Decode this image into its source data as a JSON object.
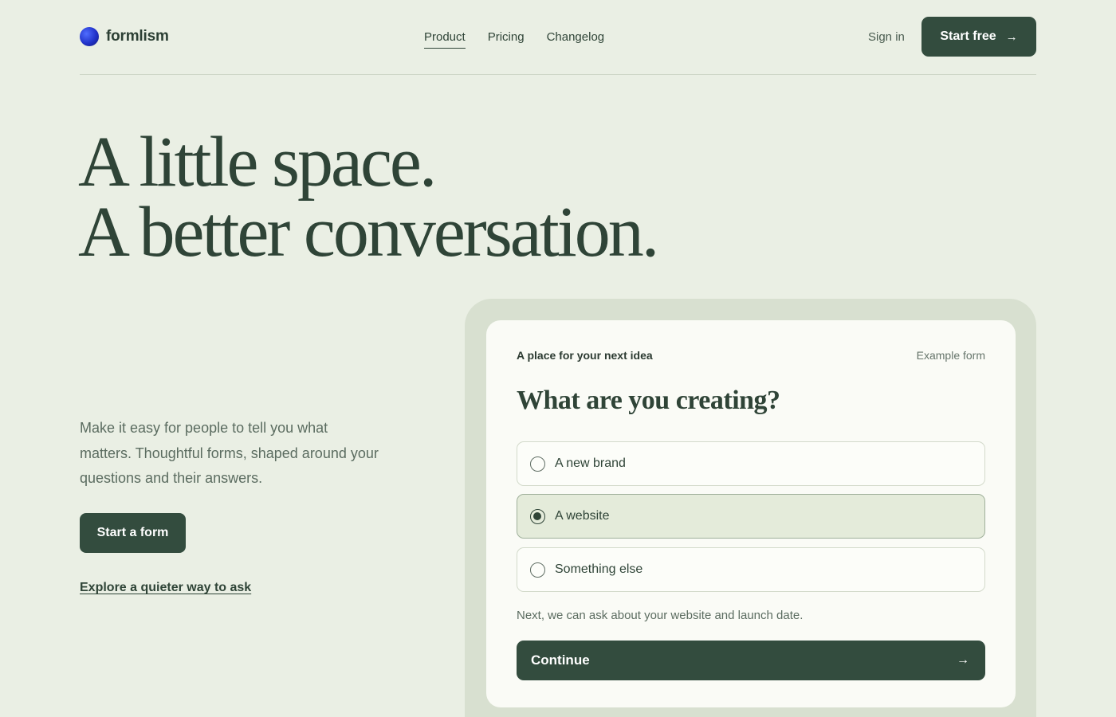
{
  "brand": {
    "name": "formlism",
    "logo_icon": "globe-logo-icon",
    "logo_color": "#2132c9"
  },
  "nav": {
    "items": [
      {
        "label": "Product",
        "active": true
      },
      {
        "label": "Pricing",
        "active": false
      },
      {
        "label": "Changelog",
        "active": false
      }
    ],
    "sign_in": "Sign in",
    "cta": {
      "label": "Start free",
      "icon": "arrow-right-icon"
    }
  },
  "hero": {
    "line1": "A little space.",
    "line2": "A better conversation.",
    "lede": "Make it easy for people to tell you what matters. Thoughtful forms, shaped around your questions and their answers.",
    "primary_button": "Start a form",
    "secondary_link": "Explore a quieter way to ask"
  },
  "form": {
    "eyebrow": "A place for your next idea",
    "tag": "Example form",
    "question": "What are you creating?",
    "options": [
      {
        "label": "A new brand",
        "selected": false
      },
      {
        "label": "A website",
        "selected": true
      },
      {
        "label": "Something else",
        "selected": false
      }
    ],
    "hint": "Next, we can ask about your website and launch date.",
    "continue_label": "Continue",
    "continue_icon": "arrow-right-icon"
  },
  "colors": {
    "background": "#eaefe4",
    "primary": "#334c3e",
    "card": "#fafbf6",
    "card_frame": "#d8e0d0",
    "selected": "#e4ebda"
  }
}
